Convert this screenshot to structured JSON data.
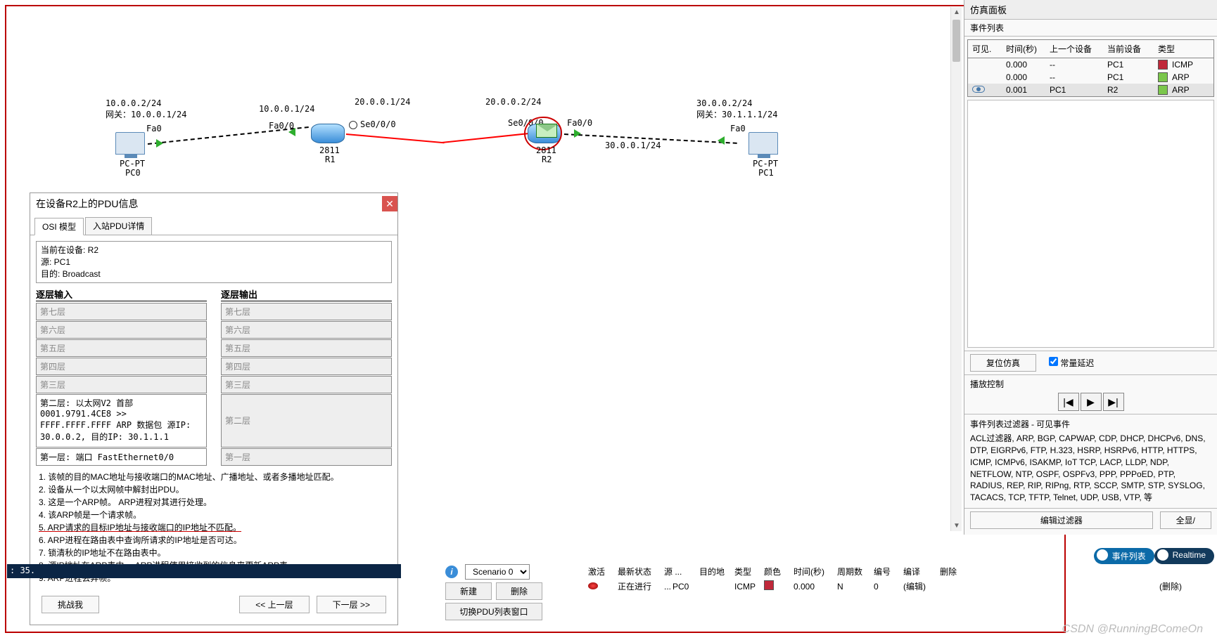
{
  "topology": {
    "pc0": {
      "ip": "10.0.0.2/24",
      "gw": "网关：10.0.0.1/24",
      "iface": "Fa0",
      "label1": "PC-PT",
      "label2": "PC0"
    },
    "r1": {
      "ip": "10.0.0.1/24",
      "ifaceL": "Fa0/0",
      "ifaceR": "Se0/0/0",
      "wan": "20.0.0.1/24",
      "label1": "2811",
      "label2": "R1"
    },
    "r2": {
      "wanL": "20.0.0.2/24",
      "ifaceL": "Se0/0/0",
      "ifaceR": "Fa0/0",
      "lan": "30.0.0.1/24",
      "label1": "2811",
      "label2": "R2"
    },
    "pc1": {
      "ip": "30.0.0.2/24",
      "gw": "网关：30.1.1.1/24",
      "iface": "Fa0",
      "label1": "PC-PT",
      "label2": "PC1"
    }
  },
  "pdu": {
    "title": "在设备R2上的PDU信息",
    "tabs": {
      "osi": "OSI 模型",
      "inbound": "入站PDU详情"
    },
    "info": {
      "l1": "当前在设备: R2",
      "l2": "源: PC1",
      "l3": "目的: Broadcast"
    },
    "colIn": "逐层输入",
    "colOut": "逐层输出",
    "layers": {
      "l7": "第七层",
      "l6": "第六层",
      "l5": "第五层",
      "l4": "第四层",
      "l3": "第三层",
      "l2": "第二层",
      "l1": "第一层"
    },
    "layer2_in": "第二层:  以太网V2 首部 0001.9791.4CE8 >> FFFF.FFFF.FFFF ARP 数据包 源IP: 30.0.0.2, 目的IP: 30.1.1.1",
    "layer1_in": "第一层:  端口 FastEthernet0/0",
    "steps": {
      "s1": "1.  该帧的目的MAC地址与接收端口的MAC地址、广播地址、或者多播地址匹配。",
      "s2": "2.  设备从一个以太网帧中解封出PDU。",
      "s3": "3.  这是一个ARP帧。 ARP进程对其进行处理。",
      "s4": "4.  该ARP帧是一个请求帧。",
      "s5": "5.  ARP请求的目标IP地址与接收端口的IP地址不匹配。",
      "s6": "6.  ARP进程在路由表中查询所请求的IP地址是否可达。",
      "s7": "7.  锁清秋的IP地址不在路由表中。",
      "s8": "8.  源IP地址在ARP表中。 ARP进程使用接收到的信息来更新ARP表。",
      "s9": "9.  ARP进程丢弃帧。"
    },
    "btns": {
      "challenge": "挑战我",
      "prev": "<< 上一层",
      "next": "下一层 >>"
    }
  },
  "sim": {
    "title": "仿真面板",
    "eventList": "事件列表",
    "cols": {
      "vis": "可见.",
      "time": "时间(秒)",
      "last": "上一个设备",
      "cur": "当前设备",
      "type": "类型"
    },
    "rows": [
      {
        "time": "0.000",
        "last": "--",
        "cur": "PC1",
        "type": "ICMP",
        "color": "#c0283a"
      },
      {
        "time": "0.000",
        "last": "--",
        "cur": "PC1",
        "type": "ARP",
        "color": "#7bc74c"
      },
      {
        "time": "0.001",
        "last": "PC1",
        "cur": "R2",
        "type": "ARP",
        "color": "#7bc74c",
        "selected": true,
        "eye": true
      }
    ],
    "reset": "复位仿真",
    "constDelay": "常量延迟",
    "playTitle": "播放控制",
    "filterTitle": "事件列表过滤器 - 可见事件",
    "filterText": "ACL过滤器, ARP, BGP, CAPWAP, CDP, DHCP, DHCPv6, DNS, DTP, EIGRPv6, FTP, H.323, HSRP, HSRPv6, HTTP, HTTPS, ICMP, ICMPv6, ISAKMP, IoT TCP, LACP, LLDP, NDP, NETFLOW, NTP, OSPF, OSPFv3, PPP, PPPoED, PTP, RADIUS, REP, RIP, RIPng, RTP, SCCP, SMTP, STP, SYSLOG, TACACS, TCP, TFTP, Telnet, UDP, USB, VTP, 等",
    "editFilter": "编辑过滤器",
    "showAll": "全显/"
  },
  "bottom": {
    "time": ": 35.",
    "scenario": "Scenario 0",
    "new": "新建",
    "del": "删除",
    "toggle": "切换PDU列表窗口",
    "hdr": {
      "act": "激活",
      "state": "最新状态",
      "src": "源 ...",
      "dst": "目的地",
      "type": "类型",
      "color": "颜色",
      "time": "时间(秒)",
      "period": "周期数",
      "num": "编号",
      "edit": "编译",
      "delete": "删除"
    },
    "row": {
      "state": "正在进行",
      "src": "PC0",
      "dst": "",
      "type": "ICMP",
      "time": "0.000",
      "period": "N",
      "num": "0",
      "edit": "(编辑)",
      "delete": "(删除)"
    },
    "pillA": "事件列表",
    "pillB": "Realtime"
  },
  "watermark": "CSDN @RunningBComeOn"
}
